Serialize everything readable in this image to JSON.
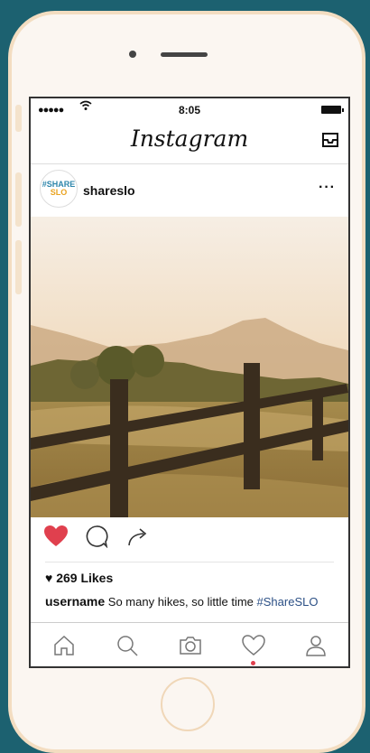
{
  "status_bar": {
    "signal": "●●●●●",
    "time": "8:05"
  },
  "app": {
    "title": "Instagram"
  },
  "post": {
    "avatar_line1": "#SHARE",
    "avatar_line2": "SLO",
    "account": "shareslo",
    "more": "···",
    "likes": "269 Likes",
    "caption_user": "username",
    "caption_text": "So many hikes, so little time",
    "caption_hashtag": "#ShareSLO"
  },
  "colors": {
    "background": "#1c6170",
    "like_red": "#e0404e",
    "hashtag_blue": "#2b4f85",
    "phone_frame": "#f3ddc1"
  },
  "icons": [
    "wifi-icon",
    "inbox-icon",
    "heart-filled-icon",
    "comment-icon",
    "share-icon",
    "home-icon",
    "search-icon",
    "camera-icon",
    "heart-outline-icon",
    "profile-icon"
  ]
}
